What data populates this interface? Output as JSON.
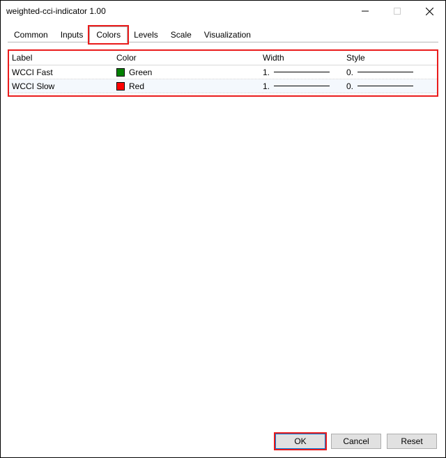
{
  "window": {
    "title": "weighted-cci-indicator 1.00"
  },
  "tabs": {
    "common": "Common",
    "inputs": "Inputs",
    "colors": "Colors",
    "levels": "Levels",
    "scale": "Scale",
    "visualization": "Visualization"
  },
  "grid": {
    "headers": {
      "label": "Label",
      "color": "Color",
      "width": "Width",
      "style": "Style"
    },
    "rows": [
      {
        "label": "WCCI Fast",
        "color_name": "Green",
        "width": "1.",
        "style": "0."
      },
      {
        "label": "WCCI Slow",
        "color_name": "Red",
        "width": "1.",
        "style": "0."
      }
    ]
  },
  "buttons": {
    "ok": "OK",
    "cancel": "Cancel",
    "reset": "Reset"
  }
}
